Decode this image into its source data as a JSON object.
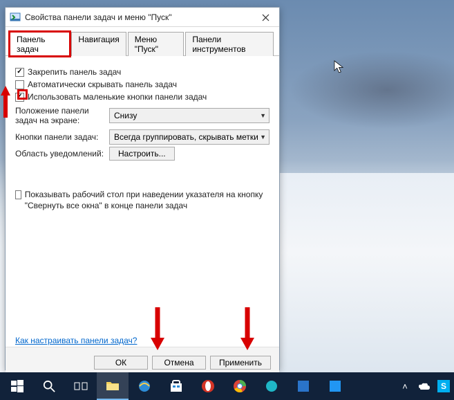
{
  "window": {
    "title": "Свойства панели задач и меню \"Пуск\""
  },
  "tabs": {
    "taskbar": "Панель задач",
    "navigation": "Навигация",
    "startmenu": "Меню \"Пуск\"",
    "toolpanels": "Панели инструментов"
  },
  "checks": {
    "lock": "Закрепить панель задач",
    "autohide": "Автоматически скрывать панель задач",
    "smallbuttons": "Использовать маленькие кнопки панели задач",
    "peek": "Показывать рабочий стол при наведении указателя на кнопку \"Свернуть все окна\" в конце панели задач"
  },
  "labels": {
    "position": "Положение панели задач на экране:",
    "buttons": "Кнопки панели задач:",
    "notify": "Область уведомлений:"
  },
  "selects": {
    "position_value": "Снизу",
    "buttons_value": "Всегда группировать, скрывать метки"
  },
  "buttons": {
    "configure": "Настроить...",
    "ok": "ОК",
    "cancel": "Отмена",
    "apply": "Применить"
  },
  "help_link": "Как настраивать панели задач?"
}
